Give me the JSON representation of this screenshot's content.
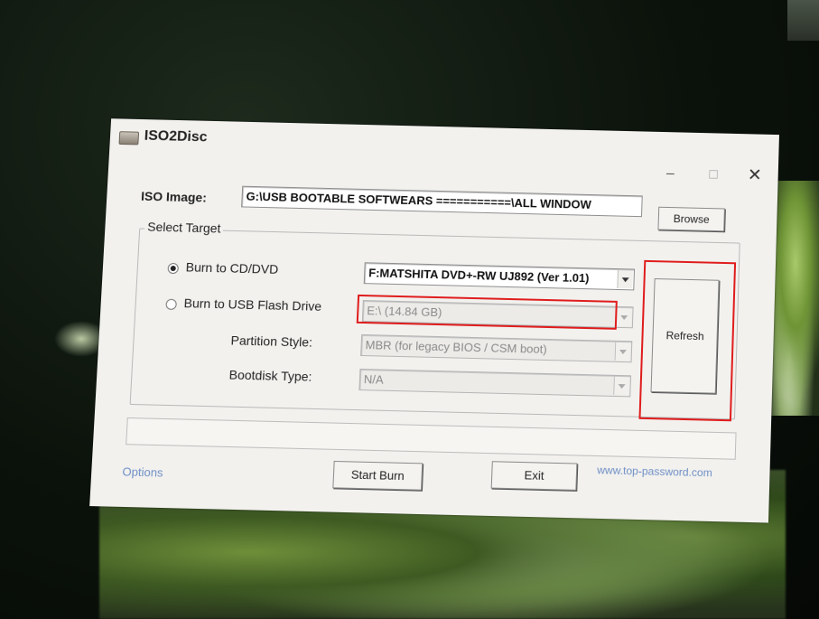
{
  "window": {
    "title": "ISO2Disc",
    "controls": {
      "minimize": "–",
      "maximize": "☐",
      "close": "✕"
    }
  },
  "iso": {
    "label": "ISO Image:",
    "path": "G:\\USB BOOTABLE  SOFTWEARS ===========\\ALL WINDOW",
    "browse_label": "Browse"
  },
  "target": {
    "group_title": "Select Target",
    "cd_label": "Burn to CD/DVD",
    "cd_selected": true,
    "cd_drive": "F:MATSHITA DVD+-RW UJ892 (Ver 1.01)",
    "usb_label": "Burn to USB Flash Drive",
    "usb_selected": false,
    "usb_drive": "E:\\ (14.84 GB)",
    "partition_label": "Partition Style:",
    "partition_value": "MBR (for legacy BIOS / CSM boot)",
    "bootdisk_label": "Bootdisk Type:",
    "bootdisk_value": "N/A",
    "refresh_label": "Refresh"
  },
  "footer": {
    "options_label": "Options",
    "start_label": "Start Burn",
    "exit_label": "Exit",
    "website": "www.top-password.com"
  },
  "colors": {
    "highlight": "#e01c1c",
    "link": "#6f8fc6",
    "window_bg": "#f2f1ee"
  }
}
